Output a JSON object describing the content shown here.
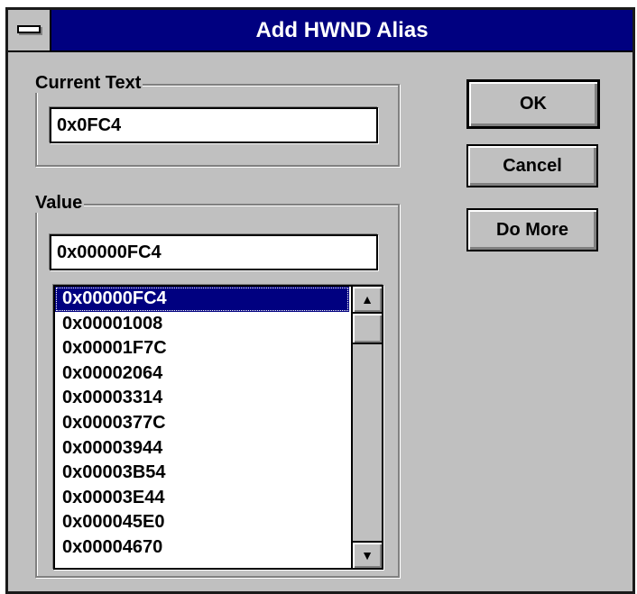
{
  "window": {
    "title": "Add HWND Alias"
  },
  "current_text": {
    "group_label": "Current Text",
    "value": "0x0FC4"
  },
  "value_group": {
    "group_label": "Value",
    "value": "0x00000FC4",
    "list_items": [
      "0x00000FC4",
      "0x00001008",
      "0x00001F7C",
      "0x00002064",
      "0x00003314",
      "0x0000377C",
      "0x00003944",
      "0x00003B54",
      "0x00003E44",
      "0x000045E0",
      "0x00004670"
    ],
    "selected_index": 0
  },
  "buttons": {
    "ok_label": "OK",
    "cancel_label": "Cancel",
    "do_more_label": "Do More"
  },
  "icons": {
    "system_menu": "system-menu-icon",
    "scroll_up": "scroll-up-arrow-icon",
    "scroll_down": "scroll-down-arrow-icon"
  },
  "colors": {
    "titlebar": "#000080",
    "dialog_face": "#c0c0c0",
    "selection": "#000080"
  }
}
